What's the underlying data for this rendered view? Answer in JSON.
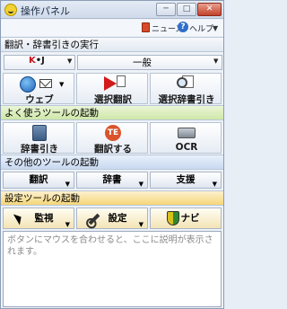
{
  "window": {
    "title": "操作パネル",
    "minimize_glyph": "─",
    "maximize_glyph": "□",
    "close_glyph": "✕"
  },
  "header": {
    "news_label": "ニュース",
    "help_label": "ヘルプ",
    "help_glyph": "?",
    "help_arrow": "▼"
  },
  "sections": {
    "translate": "翻訳・辞書引きの実行",
    "frequent": "よく使うツールの起動",
    "other": "その他のツールの起動",
    "settings": "設定ツールの起動"
  },
  "translate_row": {
    "direction_label_k": "K",
    "direction_label_rest": "•J",
    "direction_arrow": "▼",
    "mode_value": "一般",
    "mode_arrow": "▼"
  },
  "main_buttons": [
    {
      "label": "ウェブ",
      "icon": "globe-mail-icon"
    },
    {
      "label": "選択翻訳",
      "icon": "play-document-icon"
    },
    {
      "label": "選択辞書引き",
      "icon": "magnifier-document-icon"
    }
  ],
  "frequent_buttons": [
    {
      "label": "辞書引き",
      "icon": "dictionary-book-icon"
    },
    {
      "label": "翻訳する",
      "icon": "te-translate-icon",
      "icon_text": "TE"
    },
    {
      "label": "OCR",
      "icon": "scanner-icon"
    }
  ],
  "other_buttons": [
    {
      "label": "翻訳",
      "arrow": "▼"
    },
    {
      "label": "辞書",
      "arrow": "▼"
    },
    {
      "label": "支援",
      "arrow": "▼"
    }
  ],
  "settings_buttons": [
    {
      "label": "監視",
      "arrow": "▼",
      "icon": "cursor-icon"
    },
    {
      "label": "設定",
      "arrow": "▼",
      "icon": "wrench-icon"
    },
    {
      "label": "ナビ",
      "icon": "shield-icon"
    }
  ],
  "description": "ボタンにマウスを合わせると、ここに説明が表示されます。",
  "colors": {
    "translate_header": "#e2e8f1",
    "frequent_header": "#cfe7a8",
    "other_header": "#c9d9f1",
    "settings_header": "#f5d679",
    "accent_red": "#d21b1b"
  }
}
